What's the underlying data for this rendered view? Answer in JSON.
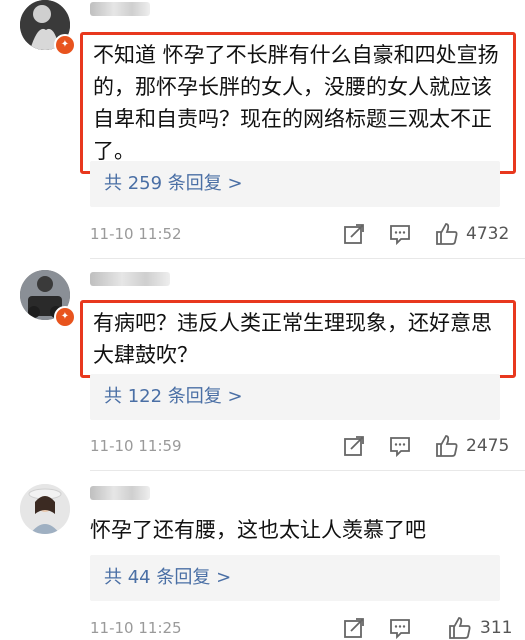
{
  "comments": [
    {
      "text": "不知道 怀孕了不长胖有什么自豪和四处宣扬的，那怀孕长胖的女人，没腰的女人就应该自卑和自责吗？现在的网络标题三观太不正了。",
      "replies": "共 259 条回复 >",
      "time": "11-10 11:52",
      "likes": "4732"
    },
    {
      "text": "有病吧？违反人类正常生理现象，还好意思大肆鼓吹？",
      "replies": "共 122 条回复 >",
      "time": "11-10 11:59",
      "likes": "2475"
    },
    {
      "text": "怀孕了还有腰，这也太让人羡慕了吧",
      "replies": "共 44 条回复 >",
      "time": "11-10 11:25",
      "likes": "311"
    }
  ],
  "icons": {
    "share": "share-icon",
    "comment": "comment-icon",
    "like": "thumbs-up-icon",
    "badge": "verified-badge-icon"
  },
  "colors": {
    "highlight_border": "#e8381e",
    "reply_link": "#4a6fa5",
    "badge": "#e8541e"
  }
}
